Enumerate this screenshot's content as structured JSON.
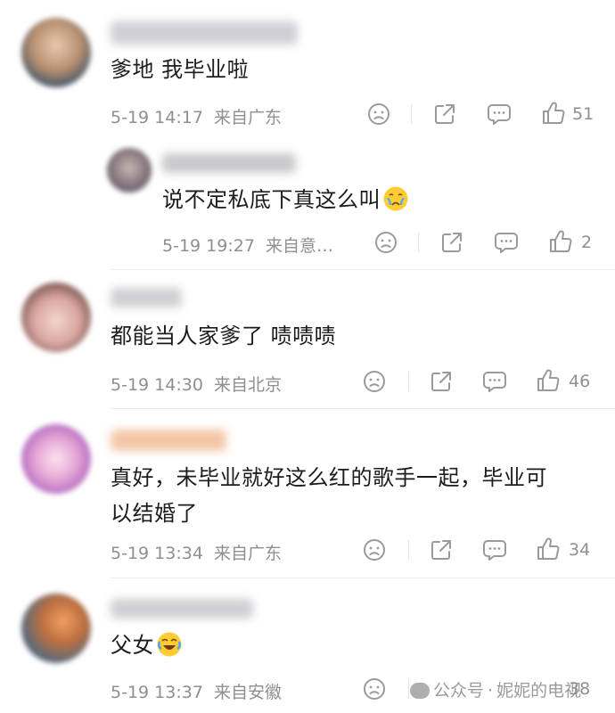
{
  "comments": [
    {
      "text": "爹地 我毕业啦",
      "time": "5-19 14:17",
      "location": "来自广东",
      "likes": "51"
    },
    {
      "text": "说不定私底下真这么叫",
      "time": "5-19 19:27",
      "location": "来自意…",
      "likes": "2"
    },
    {
      "text": "都能当人家爹了 啧啧啧",
      "time": "5-19 14:30",
      "location": "来自北京",
      "likes": "46"
    },
    {
      "text_line1": "真好，未毕业就好这么红的歌手一起，毕业可",
      "text_line2": "以结婚了",
      "time": "5-19 13:34",
      "location": "来自广东",
      "likes": "34"
    },
    {
      "text": "父女",
      "time": "5-19 13:37",
      "location": "来自安徽",
      "likes": "38"
    }
  ],
  "watermark": {
    "source": "公众号",
    "name": "妮妮的电视"
  },
  "colors": {
    "meta": "#8f8f8f",
    "icon": "#9a9a9a",
    "text": "#1c1c1c"
  },
  "icons": [
    "dislike-icon",
    "share-icon",
    "comment-icon",
    "like-icon",
    "teary-face-emoji",
    "laughing-crying-emoji"
  ]
}
